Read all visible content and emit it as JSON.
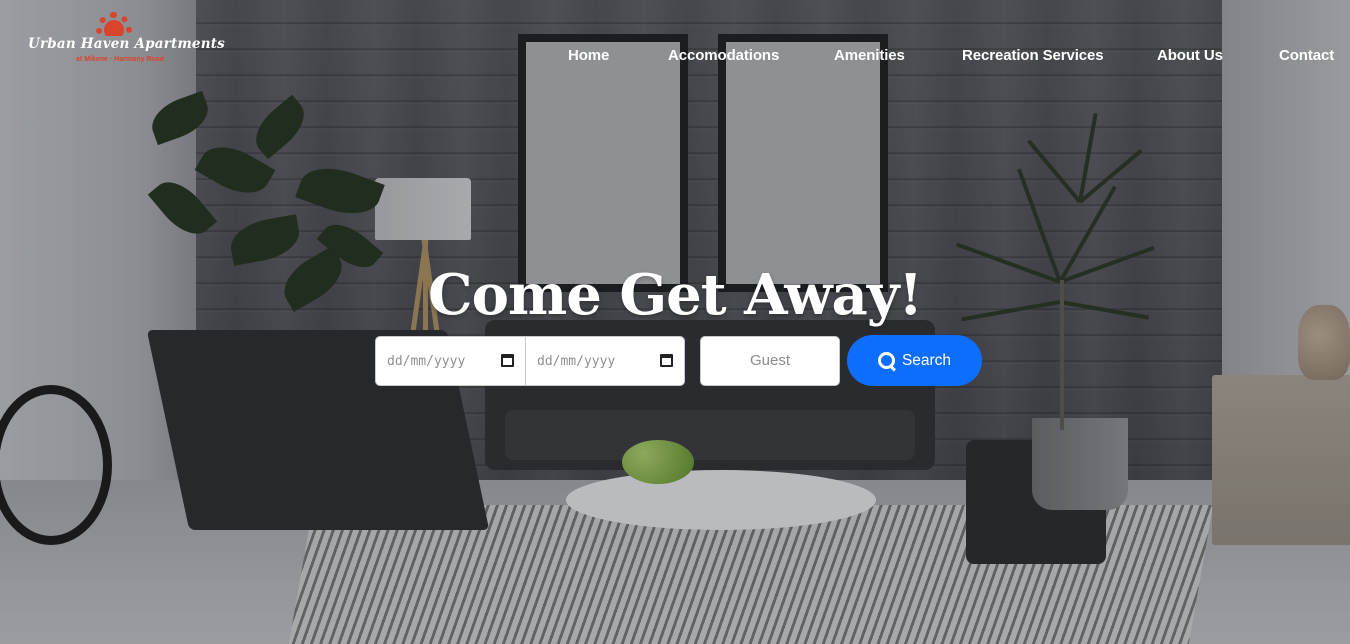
{
  "brand": {
    "title": "Urban Haven Apartments",
    "tagline": "at Mikene · Harmony Road"
  },
  "nav": {
    "items": [
      {
        "label": "Home"
      },
      {
        "label": "Accomodations"
      },
      {
        "label": "Amenities"
      },
      {
        "label": "Recreation Services"
      },
      {
        "label": "About Us"
      },
      {
        "label": "Contact"
      }
    ]
  },
  "hero": {
    "title": "Come Get Away!"
  },
  "search": {
    "checkin_placeholder": "dd/mm/yyyy",
    "checkout_placeholder": "dd/mm/yyyy",
    "guest_placeholder": "Guest",
    "button_label": "Search",
    "button_icon": "search-icon"
  },
  "colors": {
    "accent": "#0d6efd",
    "brand_red": "#d9442d",
    "nav_text": "#ffffff"
  }
}
